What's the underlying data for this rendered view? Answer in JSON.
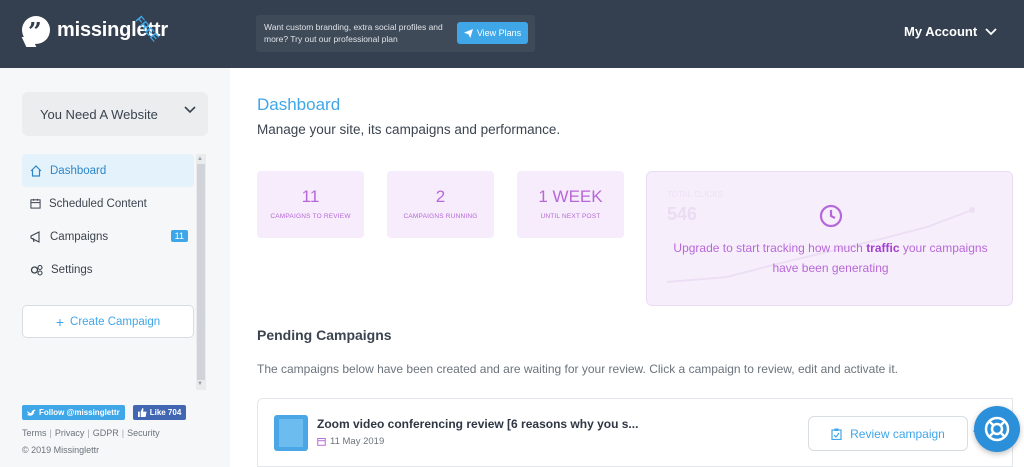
{
  "header": {
    "logo_text": "missinglettr",
    "plan_badge": "FREE",
    "promo_text": "Want custom branding, extra social profiles and more? Try out our professional plan",
    "promo_button": "View Plans",
    "account_label": "My Account"
  },
  "sidebar": {
    "site_name": "You Need A Website",
    "nav": [
      {
        "label": "Dashboard",
        "icon": "home-icon"
      },
      {
        "label": "Scheduled Content",
        "icon": "calendar-icon"
      },
      {
        "label": "Campaigns",
        "icon": "megaphone-icon",
        "count": "11"
      },
      {
        "label": "Settings",
        "icon": "gears-icon"
      }
    ],
    "create_button": "Create Campaign",
    "twitter_follow": "Follow @missinglettr",
    "facebook_like": "Like 704",
    "footer_links": [
      "Terms",
      "Privacy",
      "GDPR",
      "Security"
    ],
    "copyright": "© 2019 Missinglettr"
  },
  "main": {
    "title": "Dashboard",
    "subtitle": "Manage your site, its campaigns and performance.",
    "stats": [
      {
        "value": "11",
        "label": "CAMPAIGNS TO REVIEW"
      },
      {
        "value": "2",
        "label": "CAMPAIGNS RUNNING"
      },
      {
        "value": "1 WEEK",
        "label": "UNTIL NEXT POST"
      }
    ],
    "traffic": {
      "ghost_label": "TOTAL CLICKS",
      "ghost_value": "546",
      "message_before": "Upgrade to start tracking how much ",
      "message_bold": "traffic",
      "message_after": " your campaigns have been generating"
    },
    "pending_title": "Pending Campaigns",
    "pending_desc": "The campaigns below have been created and are waiting for your review. Click a campaign to review, edit and activate it.",
    "campaigns": [
      {
        "title": "Zoom video conferencing review [6 reasons why you s...",
        "date": "11 May 2019",
        "action": "Review campaign"
      }
    ]
  },
  "colors": {
    "topbar": "#34404f",
    "accent": "#3fa6e8",
    "stat_purple": "#b768d8",
    "stat_bg": "#f6ecfb"
  }
}
